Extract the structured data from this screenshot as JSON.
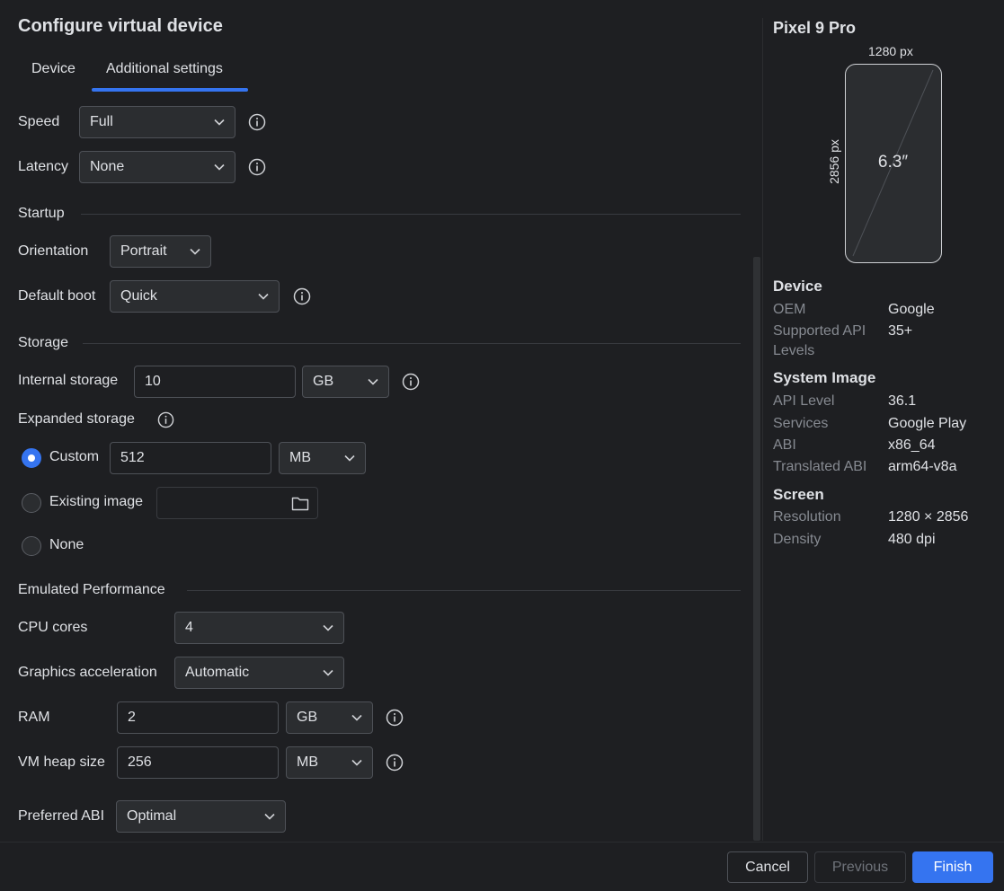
{
  "dialog": {
    "title": "Configure virtual device"
  },
  "tabs": [
    {
      "label": "Device"
    },
    {
      "label": "Additional settings"
    }
  ],
  "network": {
    "speed_label": "Speed",
    "speed_value": "Full",
    "latency_label": "Latency",
    "latency_value": "None"
  },
  "startup": {
    "section": "Startup",
    "orientation_label": "Orientation",
    "orientation_value": "Portrait",
    "boot_label": "Default boot",
    "boot_value": "Quick"
  },
  "storage": {
    "section": "Storage",
    "internal_label": "Internal storage",
    "internal_value": "10",
    "internal_unit": "GB",
    "expanded_label": "Expanded storage",
    "custom_label": "Custom",
    "custom_value": "512",
    "custom_unit": "MB",
    "existing_label": "Existing image",
    "existing_value": "",
    "none_label": "None",
    "selected": "custom"
  },
  "performance": {
    "section": "Emulated Performance",
    "cpu_label": "CPU cores",
    "cpu_value": "4",
    "graphics_label": "Graphics acceleration",
    "graphics_value": "Automatic",
    "ram_label": "RAM",
    "ram_value": "2",
    "ram_unit": "GB",
    "heap_label": "VM heap size",
    "heap_value": "256",
    "heap_unit": "MB",
    "abi_label": "Preferred ABI",
    "abi_value": "Optimal"
  },
  "preview": {
    "device_name": "Pixel 9 Pro",
    "width_label": "1280 px",
    "height_label": "2856 px",
    "diagonal": "6.3″"
  },
  "details": {
    "device_heading": "Device",
    "oem_key": "OEM",
    "oem_value": "Google",
    "api_levels_key_1": "Supported API",
    "api_levels_key_2": "Levels",
    "api_levels_value": "35+",
    "image_heading": "System Image",
    "api_level_key": "API Level",
    "api_level_value": "36.1",
    "services_key": "Services",
    "services_value": "Google Play",
    "abi_key": "ABI",
    "abi_value": "x86_64",
    "translated_abi_key": "Translated ABI",
    "translated_abi_value": "arm64-v8a",
    "screen_heading": "Screen",
    "resolution_key": "Resolution",
    "resolution_value": "1280 × 2856",
    "density_key": "Density",
    "density_value": "480 dpi"
  },
  "footer": {
    "cancel": "Cancel",
    "previous": "Previous",
    "finish": "Finish"
  },
  "colors": {
    "accent": "#3574f0",
    "background": "#1e1f22",
    "field": "#2b2d30"
  }
}
